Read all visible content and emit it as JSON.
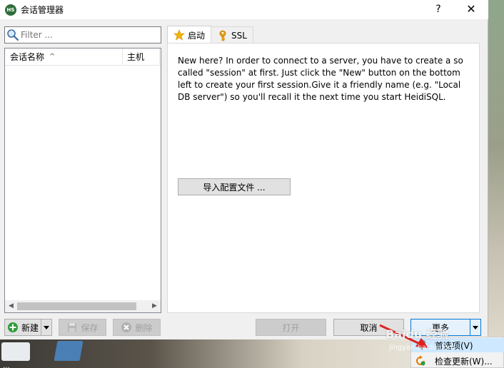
{
  "window": {
    "app_icon_text": "HS",
    "title": "会话管理器",
    "help": "?",
    "close": "✕"
  },
  "left_panel": {
    "filter_placeholder": "Filter ...",
    "columns": [
      {
        "label": "会话名称",
        "sort": "^"
      },
      {
        "label": "主机"
      }
    ],
    "scroll_left": "◀",
    "scroll_right": "▶"
  },
  "tabs": [
    {
      "label": "启动",
      "icon": "star-icon",
      "active": true
    },
    {
      "label": "SSL",
      "icon": "key-icon",
      "active": false
    }
  ],
  "start_tab": {
    "welcome_text": "New here? In order to connect to a server, you have to create a so called \"session\" at first. Just click the \"New\" button on the bottom left to create your first session.Give it a friendly name (e.g. \"Local DB server\") so you'll recall it the next time you start HeidiSQL.",
    "import_button": "导入配置文件 ..."
  },
  "buttons": {
    "new": "新建",
    "save": "保存",
    "delete": "删除",
    "open": "打开",
    "cancel": "取消",
    "more": "更多"
  },
  "more_menu": {
    "items": [
      {
        "label": "首选项(V)",
        "icon": "wrench-icon"
      },
      {
        "label": "检查更新(W)...",
        "icon": "refresh-icon"
      }
    ]
  },
  "watermark": {
    "text": "Baidu 经验",
    "url": "jingyan.baidu.com"
  },
  "desktop": {
    "icon_label": "..."
  },
  "colors": {
    "accent": "#0078d7",
    "menu_highlight": "#cde8ff",
    "star": "#f5b400",
    "key": "#e8a317",
    "new_icon": "#2e9c3a",
    "arrow": "#e02020"
  }
}
